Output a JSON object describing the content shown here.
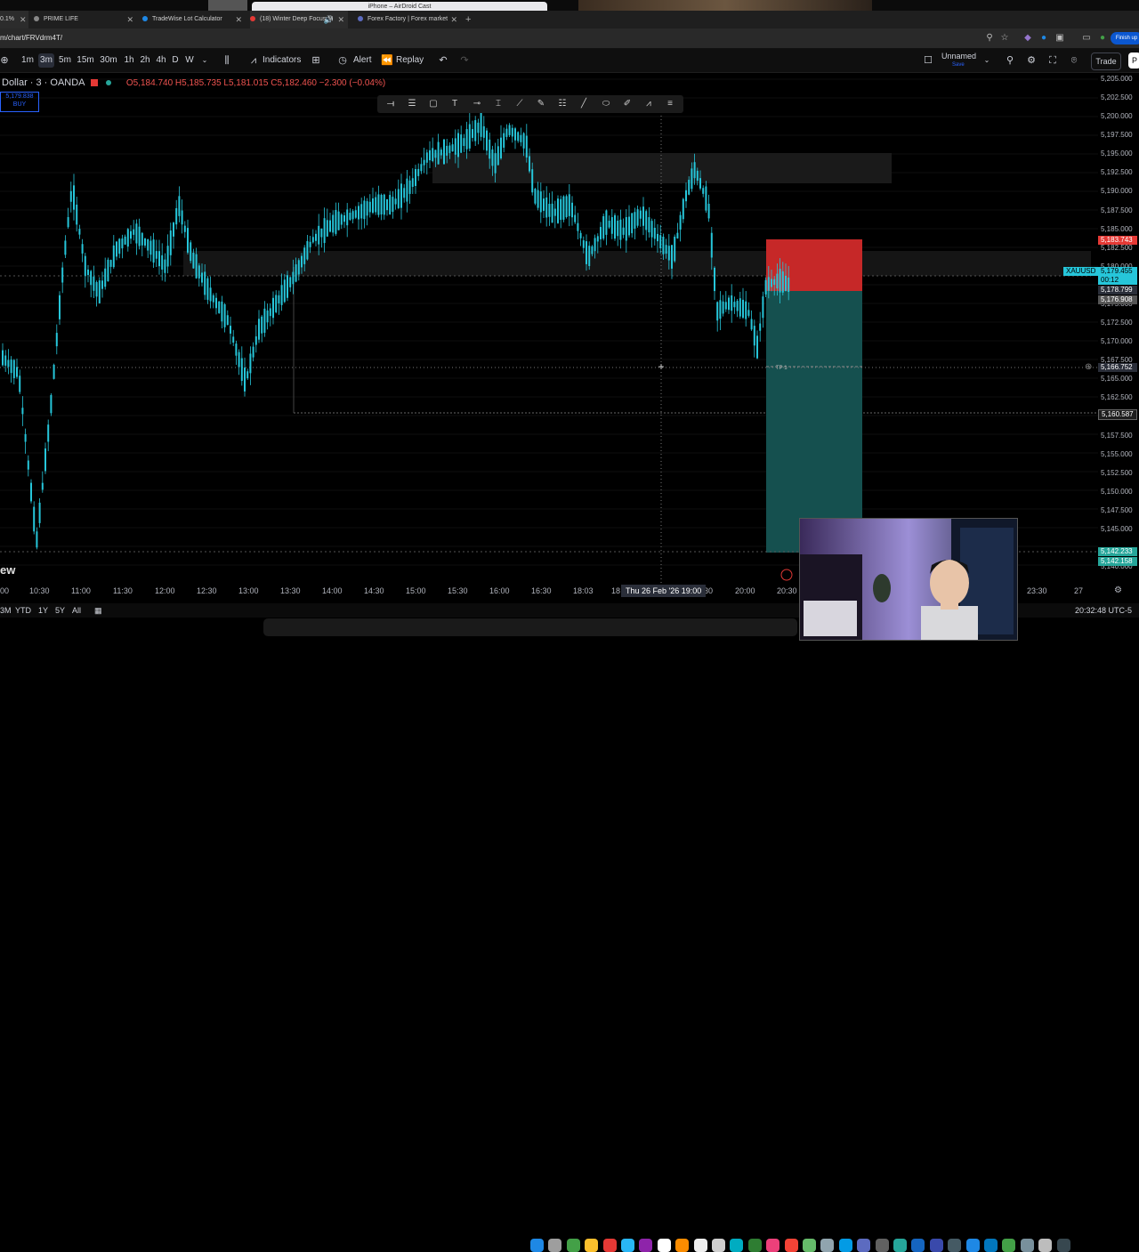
{
  "bezel": {
    "cast_title": "iPhone – AirDroid Cast"
  },
  "browser": {
    "tabs": [
      {
        "label": "0.1%",
        "active": true
      },
      {
        "label": "PRIME LIFE"
      },
      {
        "label": "TradeWise Lot Calculator"
      },
      {
        "label": "(18) Winter Deep Focus M",
        "audio": true
      },
      {
        "label": "Forex Factory | Forex market"
      }
    ],
    "url": "m/chart/FRVdrm4T/",
    "finish_label": "Finish up"
  },
  "toolbar": {
    "timeframes": [
      "1m",
      "3m",
      "5m",
      "15m",
      "30m",
      "1h",
      "2h",
      "4h",
      "D",
      "W"
    ],
    "selected_timeframe": "3m",
    "indicators_label": "Indicators",
    "alert_label": "Alert",
    "replay_label": "Replay",
    "layout_name": "Unnamed",
    "layout_sub": "Save",
    "trade_label": "Trade",
    "p_label": "P"
  },
  "legend": {
    "symbol": "Dollar · 3 · OANDA",
    "ohlc": "O5,184.740  H5,185.735  L5,181.015  C5,182.460  −2.300 (−0.04%)",
    "buy_price": "5,179.838",
    "buy_label": "BUY"
  },
  "price_axis": {
    "labels": [
      "5,205.000",
      "5,202.500",
      "5,200.000",
      "5,197.500",
      "5,195.000",
      "5,192.500",
      "5,190.000",
      "5,187.500",
      "5,185.000",
      "5,182.500",
      "5,180.000",
      "5,175.000",
      "5,172.500",
      "5,170.000",
      "5,167.500",
      "5,165.000",
      "5,162.500",
      "5,157.500",
      "5,155.000",
      "5,152.500",
      "5,150.000",
      "5,147.500",
      "5,145.000",
      "5,140.000"
    ],
    "sl_tag": "5,183.743",
    "symbol_tag": "XAUUSD",
    "current_price": "5,179.455",
    "countdown": "00:12",
    "tag_5178": "5,178.799",
    "tag_5176": "5,176.908",
    "crosshair_price": "5,166.752",
    "tag_5160": "5,160.587",
    "tag_5142a": "5,142.233",
    "tag_5142b": "5,142.158"
  },
  "time_axis": {
    "labels": [
      "00",
      "10:30",
      "11:00",
      "11:30",
      "12:00",
      "12:30",
      "13:00",
      "13:30",
      "14:00",
      "14:30",
      "15:00",
      "15:30",
      "16:00",
      "16:30",
      "18:03",
      "18",
      "30",
      "20:00",
      "20:30",
      "23:30",
      "27"
    ],
    "crosshair_date": "Thu 26 Feb '26  19:00"
  },
  "chart": {
    "tp_label": "TP 1",
    "colors": {
      "up": "#26c6da",
      "sl_zone": "#c62828",
      "tp_zone": "#15504f",
      "tag_red": "#e53935",
      "tag_cyan": "#26c6da"
    }
  },
  "bottom": {
    "ranges": [
      "3M",
      "YTD",
      "1Y",
      "5Y",
      "All"
    ],
    "clock": "20:32:48 UTC-5",
    "view_label": "ew"
  }
}
